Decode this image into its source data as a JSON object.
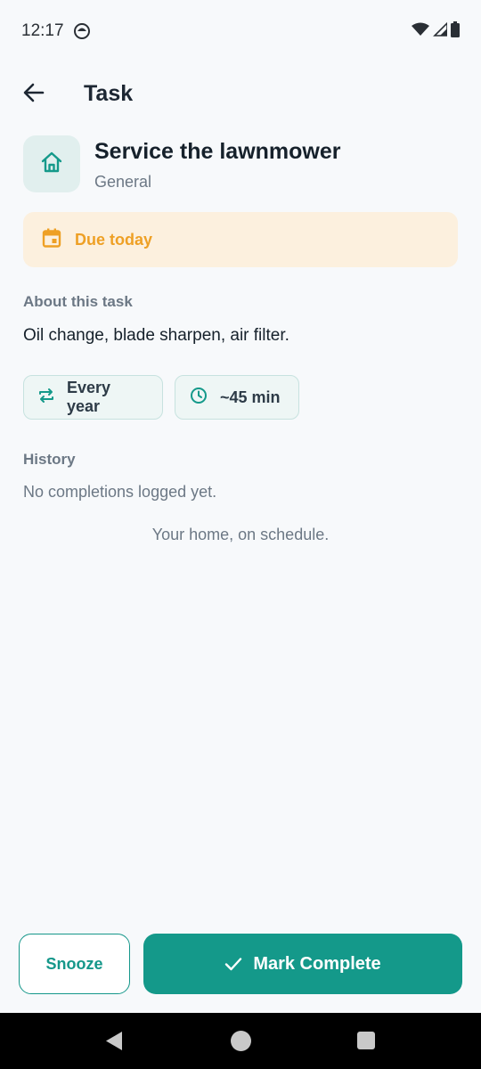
{
  "status_bar": {
    "time": "12:17"
  },
  "app_bar": {
    "title": "Task"
  },
  "task": {
    "title": "Service the lawnmower",
    "category": "General",
    "category_icon": "home-icon",
    "due_label": "Due today",
    "about_label": "About this task",
    "description": "Oil change, blade sharpen, air filter.",
    "frequency": "Every year",
    "duration": "~45 min"
  },
  "history": {
    "label": "History",
    "empty_text": "No completions logged yet."
  },
  "tagline": "Your home, on schedule.",
  "actions": {
    "snooze_label": "Snooze",
    "complete_label": "Mark Complete"
  },
  "colors": {
    "primary": "#14998a",
    "due_accent": "#eea025",
    "due_background": "#fcf0de",
    "background": "#f7f9fb"
  }
}
